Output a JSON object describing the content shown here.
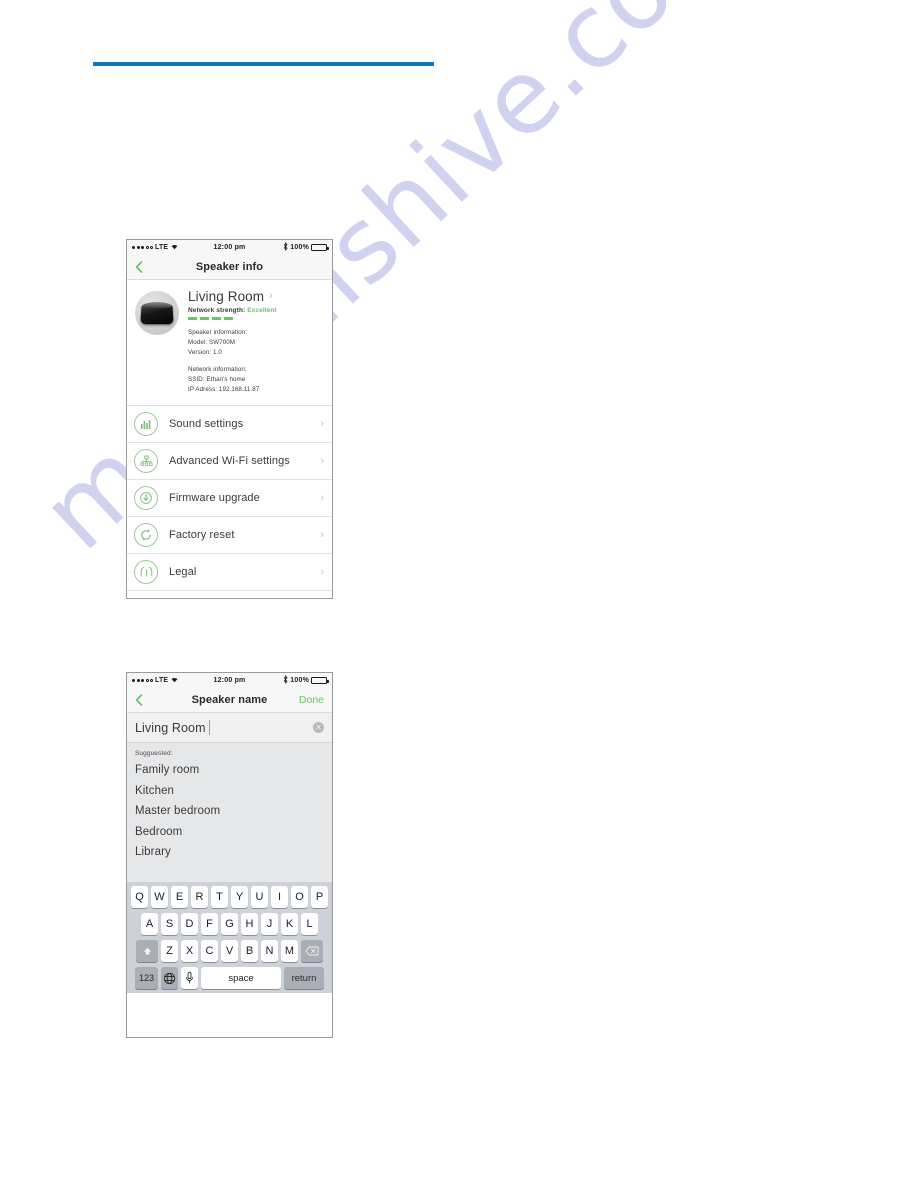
{
  "page": {
    "rule_color": "#1072b8",
    "watermark_text": "manualshive.com"
  },
  "phone_one": {
    "status_bar": {
      "carrier": "LTE",
      "time": "12:00 pm",
      "battery_percent": "100%",
      "wifi_icon": "wifi-icon",
      "bluetooth_icon": "bluetooth-icon",
      "battery_icon": "battery-full-icon"
    },
    "nav": {
      "back_icon": "chevron-left-icon",
      "title": "Speaker info"
    },
    "speaker_card": {
      "avatar_icon": "speaker-product-image",
      "name": "Living Room",
      "name_chevron": "chevron-right-icon",
      "network_strength_label": "Network strength:",
      "network_strength_value": "Excellent",
      "bars_filled": 4,
      "bars_total": 4,
      "speaker_info_heading": "Speaker information:",
      "model": "Model: SW700M",
      "version": "Version: 1.0",
      "network_info_heading": "Network information:",
      "ssid": "SSID: Ethan's home",
      "ip_address": "IP Adress: 192.168.11.87"
    },
    "settings_rows": [
      {
        "label": "Sound settings",
        "icon": "equalizer-icon",
        "chevron": "chevron-right-icon"
      },
      {
        "label": "Advanced Wi-Fi settings",
        "icon": "network-tree-icon",
        "chevron": "chevron-right-icon"
      },
      {
        "label": "Firmware upgrade",
        "icon": "download-power-icon",
        "chevron": "chevron-right-icon"
      },
      {
        "label": "Factory reset",
        "icon": "refresh-circle-icon",
        "chevron": "chevron-right-icon"
      },
      {
        "label": "Legal",
        "icon": "book-icon",
        "chevron": "chevron-right-icon"
      }
    ]
  },
  "phone_two": {
    "status_bar": {
      "carrier": "LTE",
      "time": "12:00 pm",
      "battery_percent": "100%",
      "wifi_icon": "wifi-icon",
      "bluetooth_icon": "bluetooth-icon",
      "battery_icon": "battery-full-icon"
    },
    "nav": {
      "back_icon": "chevron-left-icon",
      "title": "Speaker name",
      "action_label": "Done"
    },
    "name_field": {
      "value": "Living Room",
      "clear_icon": "clear-circle-icon"
    },
    "suggestions": {
      "label": "Sugguested:",
      "items": [
        "Family room",
        "Kitchen",
        "Master bedroom",
        "Bedroom",
        "Library"
      ]
    },
    "keyboard": {
      "row1": [
        "Q",
        "W",
        "E",
        "R",
        "T",
        "Y",
        "U",
        "I",
        "O",
        "P"
      ],
      "row2": [
        "A",
        "S",
        "D",
        "F",
        "G",
        "H",
        "J",
        "K",
        "L"
      ],
      "row3": [
        "Z",
        "X",
        "C",
        "V",
        "B",
        "N",
        "M"
      ],
      "shift_icon": "shift-up-icon",
      "backspace_icon": "backspace-icon",
      "numbers_label": "123",
      "globe_icon": "globe-icon",
      "mic_icon": "microphone-icon",
      "space_label": "space",
      "return_label": "return"
    }
  },
  "colors": {
    "accent_green": "#67c463",
    "rule_blue": "#1072b8",
    "watermark": "#c9c9ee"
  }
}
